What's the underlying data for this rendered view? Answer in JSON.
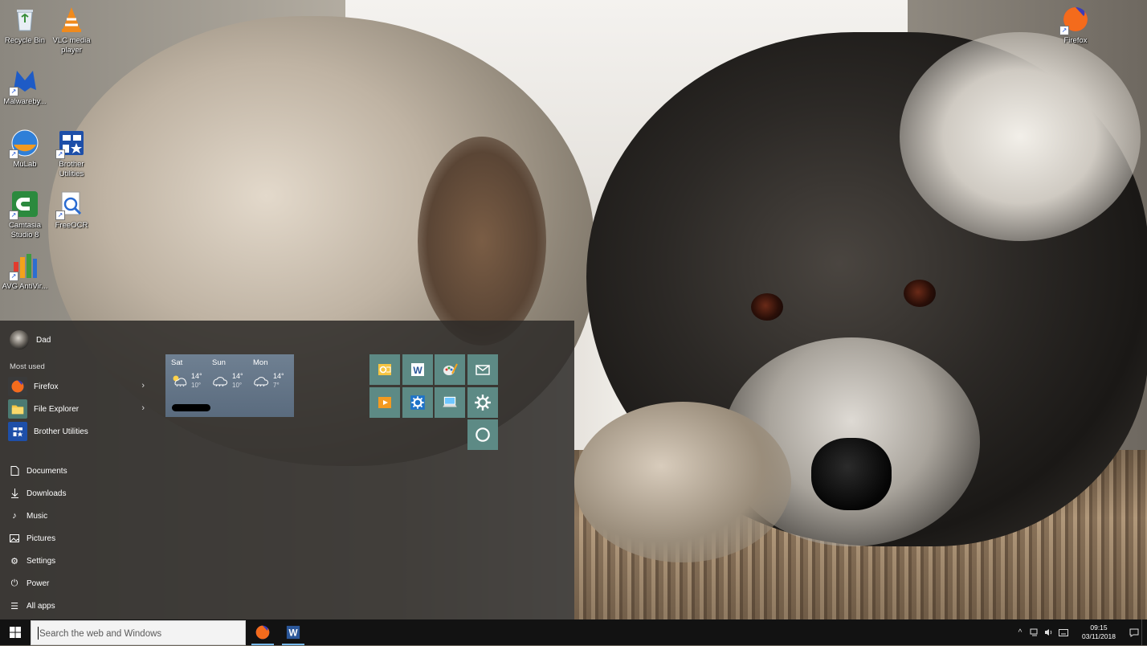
{
  "desktop": {
    "icons": [
      {
        "label": "Recycle Bin",
        "icon": "recycle-bin-icon"
      },
      {
        "label": "VLC media player",
        "icon": "vlc-icon"
      },
      {
        "label": "Malwareby...",
        "icon": "malwarebytes-icon"
      },
      {
        "label": "MuLab",
        "icon": "mulab-icon"
      },
      {
        "label": "Brother Utilities",
        "icon": "brother-utilities-icon"
      },
      {
        "label": "Camtasia Studio 8",
        "icon": "camtasia-icon"
      },
      {
        "label": "FreeOCR",
        "icon": "freeocr-icon"
      },
      {
        "label": "AVG AntiVir...",
        "icon": "avg-icon"
      },
      {
        "label": "Firefox",
        "icon": "firefox-icon"
      }
    ]
  },
  "start_menu": {
    "user_name": "Dad",
    "most_used_title": "Most used",
    "most_used": [
      {
        "label": "Firefox",
        "has_submenu": true
      },
      {
        "label": "File Explorer",
        "has_submenu": true
      },
      {
        "label": "Brother Utilities",
        "has_submenu": false
      }
    ],
    "places": [
      {
        "label": "Documents",
        "icon": "document-icon"
      },
      {
        "label": "Downloads",
        "icon": "download-icon"
      },
      {
        "label": "Music",
        "icon": "music-icon"
      },
      {
        "label": "Pictures",
        "icon": "pictures-icon"
      },
      {
        "label": "Settings",
        "icon": "gear-icon"
      },
      {
        "label": "Power",
        "icon": "power-icon"
      },
      {
        "label": "All apps",
        "icon": "list-icon"
      }
    ],
    "weather": {
      "days": [
        {
          "day": "Sat",
          "high": "14°",
          "low": "10°",
          "icon": "sun-cloud-rain-icon"
        },
        {
          "day": "Sun",
          "high": "14°",
          "low": "10°",
          "icon": "cloud-rain-icon"
        },
        {
          "day": "Mon",
          "high": "14°",
          "low": "7°",
          "icon": "cloud-rain-icon"
        }
      ]
    },
    "tiles": [
      {
        "icon": "outlook-icon"
      },
      {
        "icon": "word-icon"
      },
      {
        "icon": "paint-icon"
      },
      {
        "icon": "mail-icon"
      },
      {
        "icon": "media-player-icon"
      },
      {
        "icon": "settings-app-icon"
      },
      {
        "icon": "laptop-icon"
      },
      {
        "icon": "gear-icon"
      },
      {
        "icon": "cortana-icon"
      }
    ]
  },
  "taskbar": {
    "search_placeholder": "Search the web and Windows",
    "pinned": [
      {
        "icon": "firefox-icon",
        "label": "Firefox"
      },
      {
        "icon": "word-icon",
        "label": "Word"
      }
    ],
    "clock_time": "09:15",
    "clock_date": "03/11/2018"
  },
  "colors": {
    "tile": "#5d8a85",
    "weather_tile": "#6f8092",
    "start_bg": "#2d2b29",
    "taskbar_bg": "#121212",
    "accent": "#76b9ed"
  }
}
